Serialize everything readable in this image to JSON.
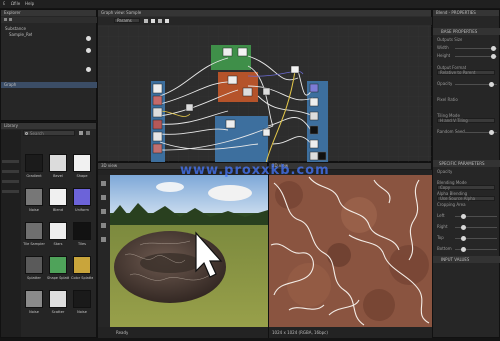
{
  "app": {
    "menubar": [
      "Ɛ",
      "Ωfile",
      "Help"
    ]
  },
  "explorer": {
    "title": "Explorer",
    "items": [
      "Substance",
      "Sample_Ref"
    ],
    "selected": "Graph"
  },
  "graph_view": {
    "title": "Graph view: Sample",
    "toolbar_field": "Params",
    "watermark": "www.proxxkb.com"
  },
  "library": {
    "title": "Library",
    "search_placeholder": "Search",
    "thumbs": [
      {
        "label": "Gradient",
        "color": "#1b1b1b"
      },
      {
        "label": "Bevel",
        "color": "#dcdcdc"
      },
      {
        "label": "Shape",
        "color": "#f1f1f1"
      },
      {
        "label": "Noise",
        "color": "#777777"
      },
      {
        "label": "Blend",
        "color": "#f0f0f0"
      },
      {
        "label": "Uniform",
        "color": "#6c63d9"
      },
      {
        "label": "Tile Sampler",
        "color": "#6f6f6f"
      },
      {
        "label": "Stars",
        "color": "#eeeeee"
      },
      {
        "label": "Tiles",
        "color": "#121212"
      },
      {
        "label": "Splatter",
        "color": "#5a5a5a"
      },
      {
        "label": "Shape Splatter",
        "color": "#4fa35a"
      },
      {
        "label": "Color Splatter",
        "color": "#c9a53b"
      },
      {
        "label": "Noise",
        "color": "#8a8a8a"
      },
      {
        "label": "Scatter",
        "color": "#dedede"
      },
      {
        "label": "Noise",
        "color": "#1a1a1a"
      }
    ]
  },
  "view3d": {
    "title": "3D view",
    "status": "Ready"
  },
  "view2d": {
    "title": "2D view",
    "status": "1024 x 1024 (RGBA, 16bpc)"
  },
  "properties": {
    "title": "Blend - PROPERTIES",
    "section1": "BASE PROPERTIES",
    "base": [
      {
        "label": "Outputs Size",
        "value": "",
        "slider": null
      },
      {
        "label": "Width",
        "value": "",
        "slider": 0.95
      },
      {
        "label": "Height",
        "value": "",
        "slider": 0.95
      }
    ],
    "groups": [
      {
        "label": "Output Format",
        "value": "Relative to Parent"
      },
      {
        "label": "Opacity",
        "value": "",
        "slider": 0.9
      },
      {
        "label": "Pixel Ratio",
        "value": ""
      },
      {
        "label": "Tiling Mode",
        "value": "H and V Tiling"
      },
      {
        "label": "Random Seed",
        "value": "",
        "slider": 0.9
      }
    ],
    "section2": "SPECIFIC PARAMETERS",
    "specific": [
      {
        "label": "Opacity",
        "value": ""
      },
      {
        "label": "Blending Mode",
        "value": "Copy"
      },
      {
        "label": "Alpha Blending",
        "value": "Use Source Alpha"
      },
      {
        "label": "Cropping Area",
        "value": ""
      },
      {
        "label": "Left",
        "value": "",
        "slider": 0.2
      },
      {
        "label": "Right",
        "value": "",
        "slider": 0.2
      },
      {
        "label": "Top",
        "value": "",
        "slider": 0.2
      },
      {
        "label": "Bottom",
        "value": "",
        "slider": 0.2
      }
    ],
    "section3": "INPUT VALUES"
  }
}
